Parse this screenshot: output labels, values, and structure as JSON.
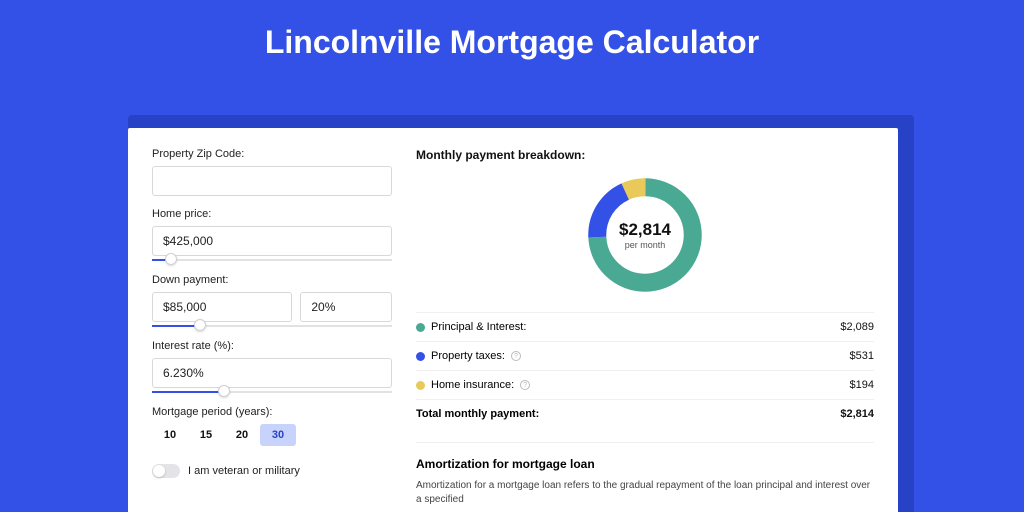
{
  "page_title": "Lincolnville Mortgage Calculator",
  "colors": {
    "accent": "#3351e6",
    "green": "#4aa993",
    "blue": "#3351e6",
    "yellow": "#e9c959"
  },
  "form": {
    "zip_label": "Property Zip Code:",
    "zip_value": "",
    "home_price_label": "Home price:",
    "home_price_value": "$425,000",
    "home_price_slider_pct": 8,
    "down_payment_label": "Down payment:",
    "down_payment_value": "$85,000",
    "down_payment_pct_value": "20%",
    "down_payment_slider_pct": 20,
    "rate_label": "Interest rate (%):",
    "rate_value": "6.230%",
    "rate_slider_pct": 30,
    "period_label": "Mortgage period (years):",
    "periods": [
      "10",
      "15",
      "20",
      "30"
    ],
    "period_selected": "30",
    "veteran_label": "I am veteran or military",
    "veteran_on": false
  },
  "breakdown": {
    "title": "Monthly payment breakdown:",
    "center_amount": "$2,814",
    "center_sub": "per month",
    "rows": [
      {
        "dot": "green",
        "label": "Principal & Interest:",
        "info": false,
        "value": "$2,089"
      },
      {
        "dot": "blue",
        "label": "Property taxes:",
        "info": true,
        "value": "$531"
      },
      {
        "dot": "yellow",
        "label": "Home insurance:",
        "info": true,
        "value": "$194"
      }
    ],
    "total_label": "Total monthly payment:",
    "total_value": "$2,814"
  },
  "chart_data": {
    "type": "pie",
    "title": "Monthly payment breakdown",
    "total": 2814,
    "unit": "per month",
    "series": [
      {
        "name": "Principal & Interest",
        "value": 2089,
        "color": "#4aa993"
      },
      {
        "name": "Property taxes",
        "value": 531,
        "color": "#3351e6"
      },
      {
        "name": "Home insurance",
        "value": 194,
        "color": "#e9c959"
      }
    ]
  },
  "amortization": {
    "title": "Amortization for mortgage loan",
    "text": "Amortization for a mortgage loan refers to the gradual repayment of the loan principal and interest over a specified"
  }
}
